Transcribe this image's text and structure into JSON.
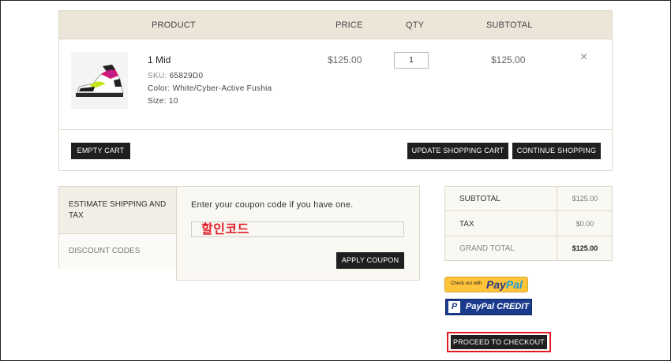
{
  "cart": {
    "headers": {
      "product": "PRODUCT",
      "price": "PRICE",
      "qty": "QTY",
      "subtotal": "SUBTOTAL"
    },
    "item": {
      "name": "1 Mid",
      "sku_label": "SKU:",
      "sku": "65829D0",
      "color_label": "Color:",
      "color": "White/Cyber-Active Fushia",
      "size_label": "Size:",
      "size": "10",
      "price": "$125.00",
      "qty": "1",
      "subtotal": "$125.00",
      "remove": "×"
    },
    "buttons": {
      "empty": "EMPTY CART",
      "update": "UPDATE SHOPPING CART",
      "continue": "CONTINUE SHOPPING"
    }
  },
  "tabs": {
    "shipping": "ESTIMATE SHIPPING AND TAX",
    "discount": "DISCOUNT CODES"
  },
  "coupon": {
    "prompt": "Enter your coupon code if you have one.",
    "annotation": "할인코드",
    "apply": "APPLY COUPON"
  },
  "totals": {
    "subtotal_label": "SUBTOTAL",
    "subtotal": "$125.00",
    "tax_label": "TAX",
    "tax": "$0.00",
    "grand_label": "GRAND TOTAL",
    "grand": "$125.00"
  },
  "paypal": {
    "small": "Check out with",
    "pay": "Pay",
    "pal": "Pal",
    "credit_logo": "P",
    "credit": "PayPal CREDIT"
  },
  "checkout": "PROCEED TO CHECKOUT",
  "colors": {
    "accent_red": "#e01b24",
    "header_bg": "#ebe6d8",
    "button": "#1f1f1f"
  }
}
